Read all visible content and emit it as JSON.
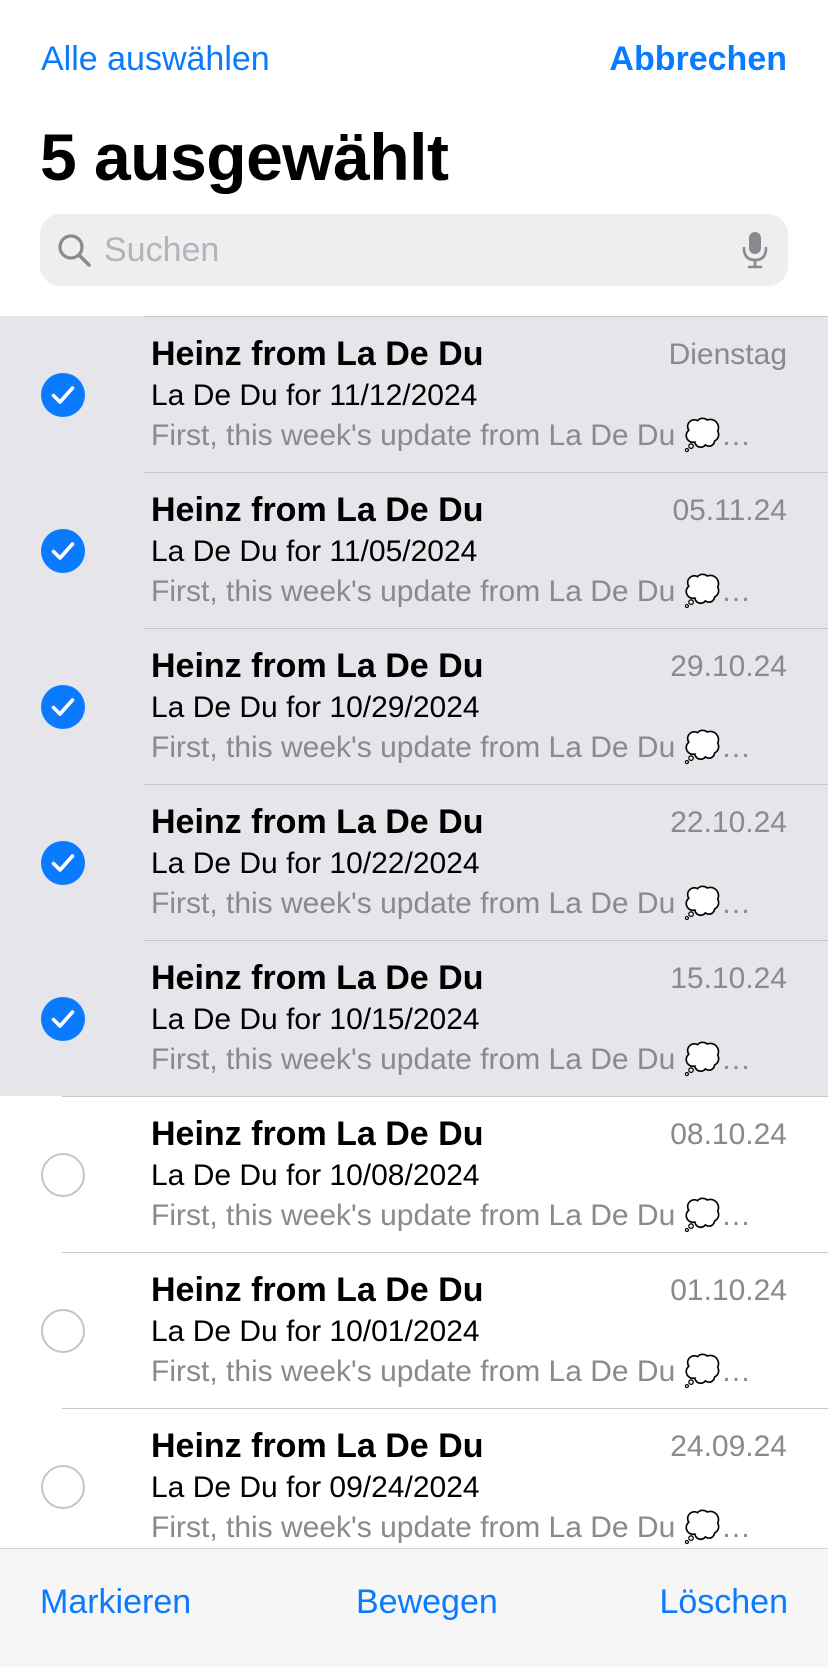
{
  "header": {
    "select_all_label": "Alle auswählen",
    "cancel_label": "Abbrechen",
    "title": "5 ausgewählt"
  },
  "search": {
    "placeholder": "Suchen",
    "icon": "magnifier-icon",
    "mic_icon": "microphone-icon"
  },
  "colors": {
    "accent": "#0a7aff",
    "selected_row": "#e5e5ea",
    "secondary_text": "#8a8a8e"
  },
  "messages": [
    {
      "sender": "Heinz from La De Du",
      "date": "Dienstag",
      "subject": "La De Du for 11/12/2024",
      "preview": "First, this week's update from La De Du",
      "preview_suffix": "…",
      "selected": true
    },
    {
      "sender": "Heinz from La De Du",
      "date": "05.11.24",
      "subject": "La De Du for 11/05/2024",
      "preview": "First, this week's update from La De Du",
      "preview_suffix": "…",
      "selected": true
    },
    {
      "sender": "Heinz from La De Du",
      "date": "29.10.24",
      "subject": "La De Du for 10/29/2024",
      "preview": "First, this week's update from La De Du",
      "preview_suffix": "…",
      "selected": true
    },
    {
      "sender": "Heinz from La De Du",
      "date": "22.10.24",
      "subject": "La De Du for 10/22/2024",
      "preview": "First, this week's update from La De Du",
      "preview_suffix": "…",
      "selected": true
    },
    {
      "sender": "Heinz from La De Du",
      "date": "15.10.24",
      "subject": "La De Du for 10/15/2024",
      "preview": "First, this week's update from La De Du",
      "preview_suffix": "…",
      "selected": true
    },
    {
      "sender": "Heinz from La De Du",
      "date": "08.10.24",
      "subject": "La De Du for 10/08/2024",
      "preview": "First, this week's update from La De Du",
      "preview_suffix": "…",
      "selected": false
    },
    {
      "sender": "Heinz from La De Du",
      "date": "01.10.24",
      "subject": "La De Du for 10/01/2024",
      "preview": "First, this week's update from La De Du",
      "preview_suffix": "…",
      "selected": false
    },
    {
      "sender": "Heinz from La De Du",
      "date": "24.09.24",
      "subject": "La De Du for 09/24/2024",
      "preview": "First, this week's update from La De Du",
      "preview_suffix": "…",
      "selected": false
    }
  ],
  "toolbar": {
    "mark_label": "Markieren",
    "move_label": "Bewegen",
    "delete_label": "Löschen"
  }
}
